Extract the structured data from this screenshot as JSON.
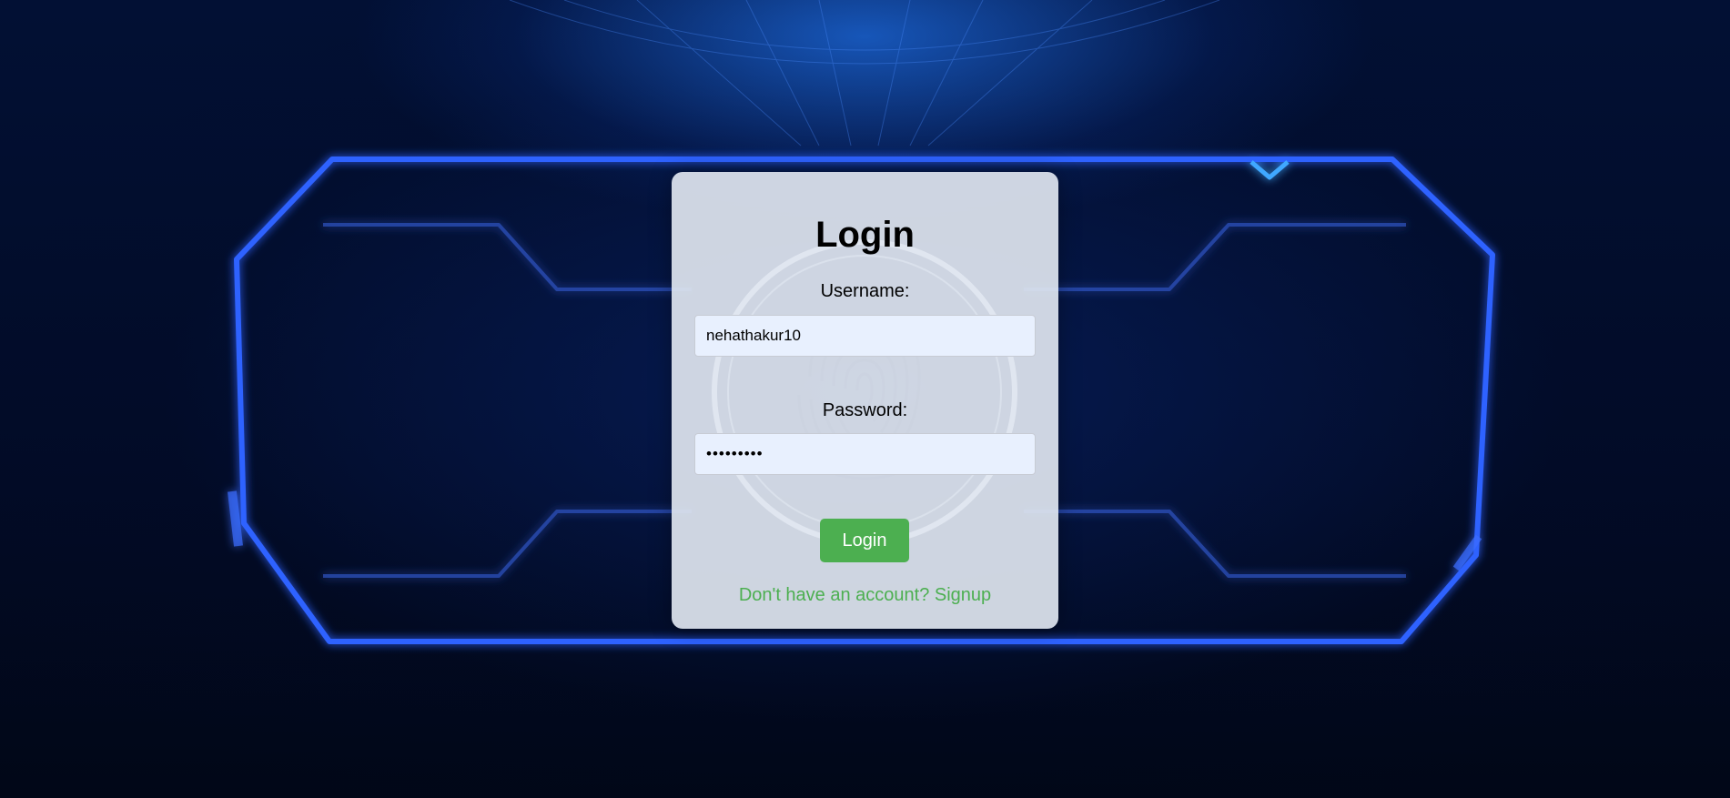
{
  "login_form": {
    "title": "Login",
    "username_label": "Username:",
    "username_value": "nehathakur10",
    "password_label": "Password:",
    "password_value": "*********",
    "submit_label": "Login",
    "signup_link": "Don't have an account? Signup"
  },
  "colors": {
    "accent_button": "#4caf50",
    "signup_link": "#4caf50",
    "input_background": "#e8f0fe",
    "card_background": "#dee4ee",
    "page_background": "#020b26",
    "frame_glow": "#2f6dff"
  }
}
